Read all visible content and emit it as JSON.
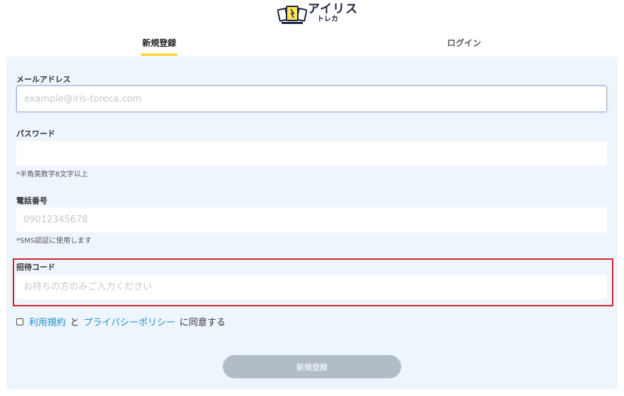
{
  "brand": {
    "name": "アイリス",
    "sub": "トレカ"
  },
  "tabs": {
    "signup": "新規登録",
    "login": "ログイン"
  },
  "form": {
    "email": {
      "label": "メールアドレス",
      "placeholder": "example@iris-toreca.com",
      "value": ""
    },
    "password": {
      "label": "パスワード",
      "placeholder": "",
      "hint": "*半角英数字8文字以上"
    },
    "phone": {
      "label": "電話番号",
      "placeholder": "09012345678",
      "hint": "*SMS認証に使用します"
    },
    "invite": {
      "label": "招待コード",
      "placeholder": "お持ちの方のみご入力ください"
    },
    "agree": {
      "terms_link": "利用規約",
      "and": "と",
      "privacy_link": "プライバシーポリシー",
      "suffix": "に同意する"
    },
    "submit_label": "新規登録"
  },
  "colors": {
    "accent_tab": "#f7d31a",
    "link": "#1f8fcb",
    "panel_bg": "#eef5fd",
    "highlight": "#d0262f",
    "submit_disabled": "#b0bcc6"
  }
}
